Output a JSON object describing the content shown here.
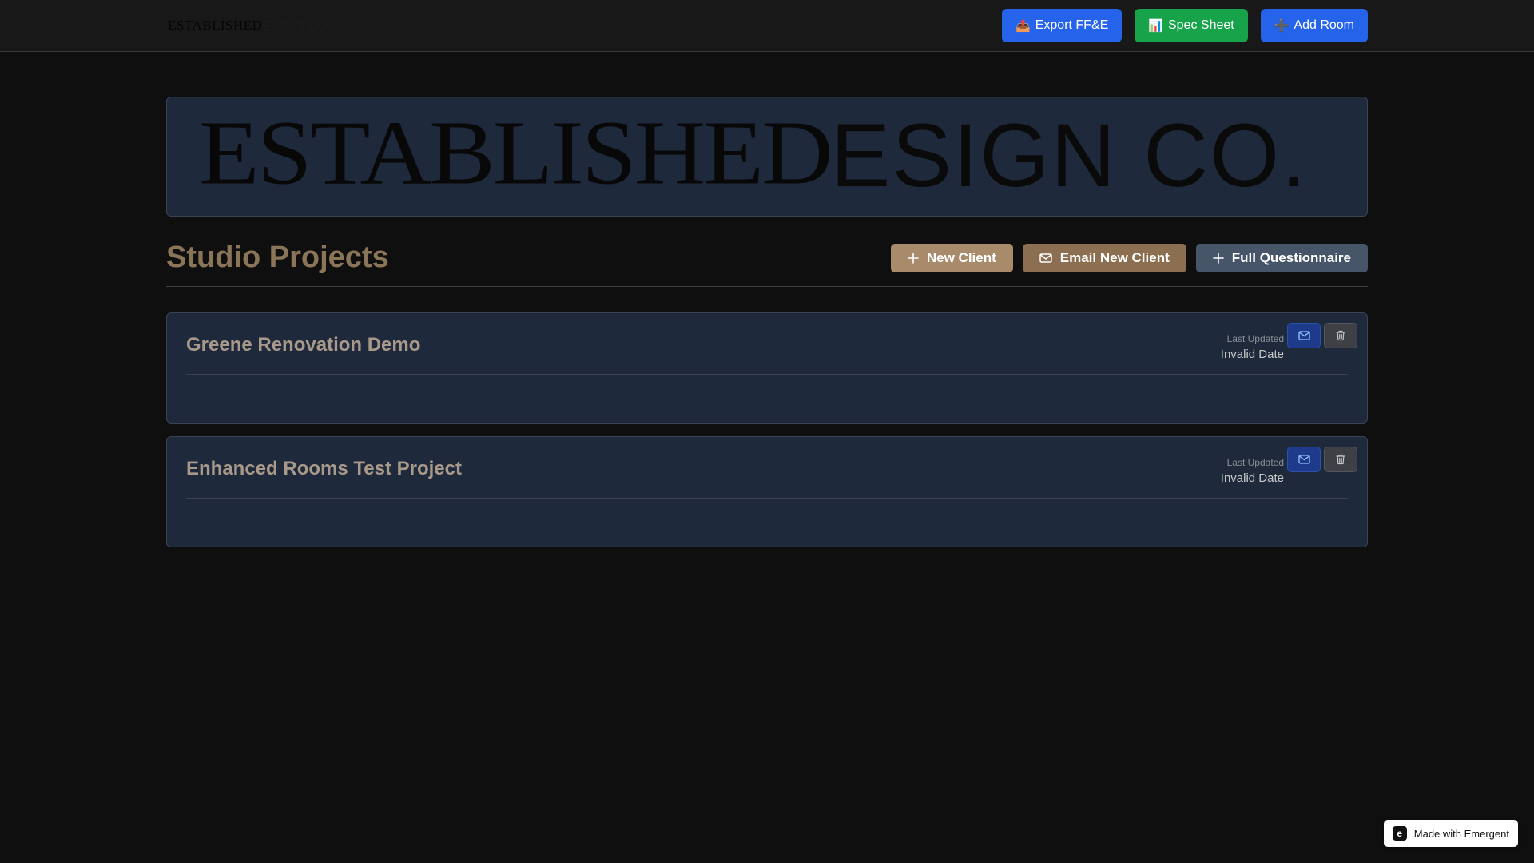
{
  "topbar": {
    "logo_bold": "ESTABLISHED",
    "logo_light": "ESIGN CO.",
    "buttons": [
      {
        "emoji": "📤",
        "label": "Export FF&E",
        "color": "#2563eb"
      },
      {
        "emoji": "📊",
        "label": "Spec Sheet",
        "color": "#16a34a"
      },
      {
        "emoji": "➕",
        "label": "Add Room",
        "color": "#2563eb"
      }
    ]
  },
  "banner": {
    "logo_bold": "ESTABLISHED",
    "logo_light": "ESIGN CO."
  },
  "header": {
    "title": "Studio Projects",
    "actions": [
      {
        "icon": "plus-icon",
        "label": "New Client"
      },
      {
        "icon": "mail-icon",
        "label": "Email New Client"
      },
      {
        "icon": "plus-icon",
        "label": "Full Questionnaire"
      }
    ]
  },
  "projects": [
    {
      "name": "Greene Renovation Demo",
      "last_updated_label": "Last Updated",
      "last_updated_value": "Invalid Date",
      "actions": [
        "mail-icon",
        "trash-icon"
      ]
    },
    {
      "name": "Enhanced Rooms Test Project",
      "last_updated_label": "Last Updated",
      "last_updated_value": "Invalid Date",
      "actions": [
        "mail-icon",
        "trash-icon"
      ]
    }
  ],
  "badge": {
    "icon": "emergent-logo-icon",
    "label": "Made with Emergent"
  },
  "colors": {
    "page_bg": "#0f0f0f",
    "card_bg": "#1e293b",
    "title_gold": "#8b7558",
    "accent_blue": "#2563eb",
    "accent_green": "#16a34a",
    "tan_button": "#a88b6b",
    "brown_button": "#8b6f50",
    "slate_button": "#475569"
  }
}
